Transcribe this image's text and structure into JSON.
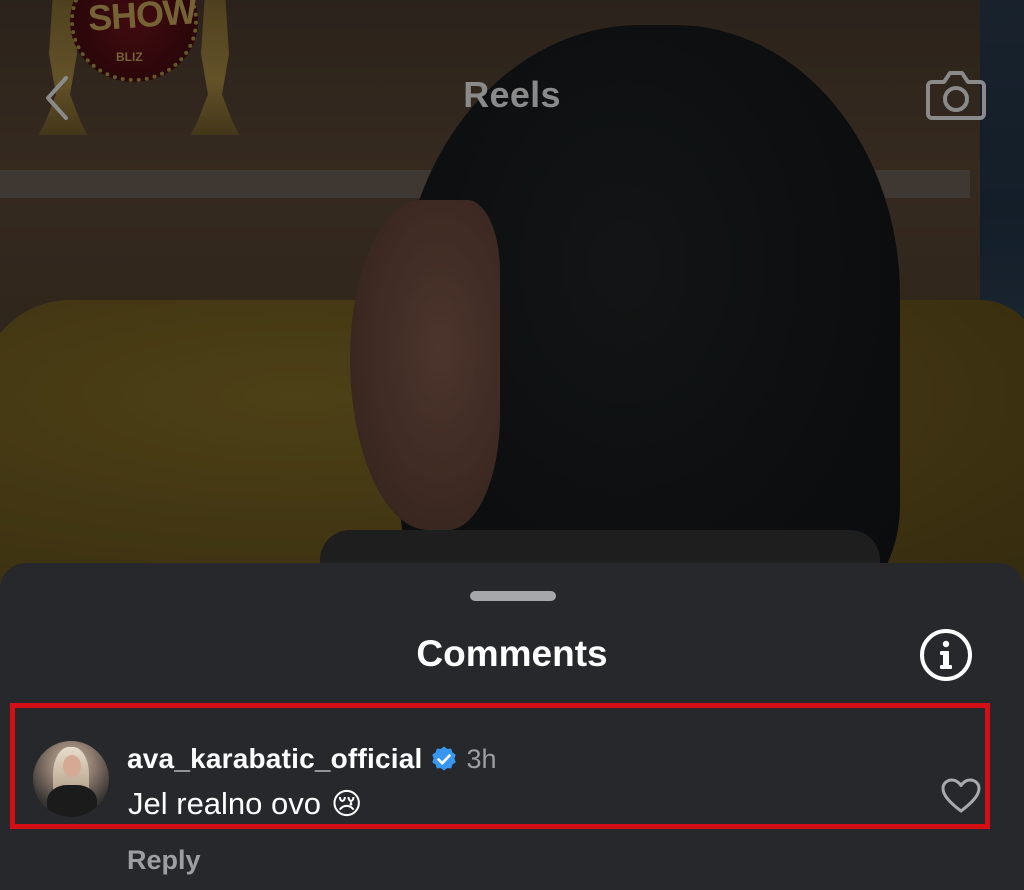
{
  "header": {
    "title": "Reels",
    "back_icon": "chevron-left-icon",
    "camera_icon": "camera-icon"
  },
  "video": {
    "logo_text": "SHOW",
    "logo_sub": "BLIZ"
  },
  "comments_sheet": {
    "title": "Comments",
    "info_icon": "info-icon",
    "comments": [
      {
        "username": "ava_karabatic_official",
        "verified": true,
        "timestamp": "3h",
        "text": "Jel realno ovo",
        "emoji": "😢",
        "reply_label": "Reply",
        "like_icon": "heart-icon",
        "highlighted": true
      }
    ]
  },
  "colors": {
    "sheet_bg": "#26282b",
    "highlight_border": "#d30e14",
    "verified_blue": "#3797f0",
    "secondary_text": "#9c9ea2"
  }
}
